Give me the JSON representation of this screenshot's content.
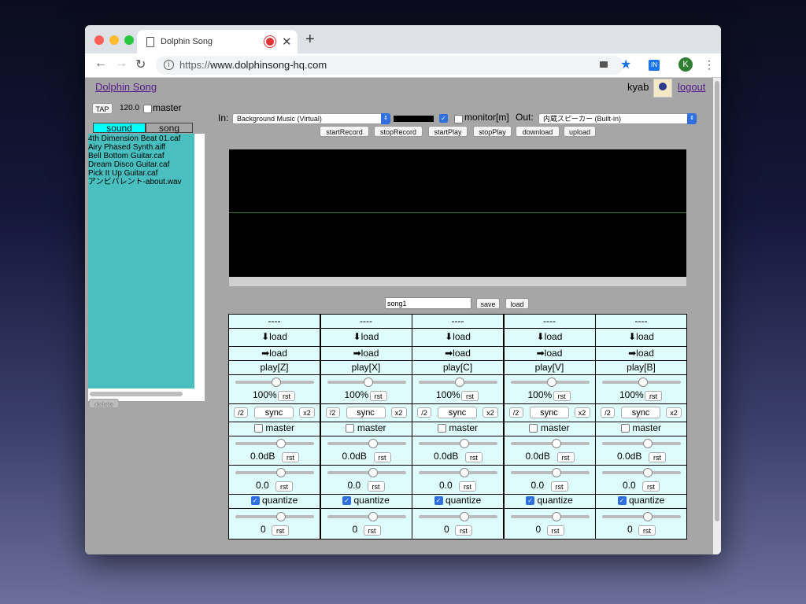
{
  "browser": {
    "tab_title": "Dolphin Song",
    "url_prefix": "https://",
    "url_host": "www.dolphinsong-hq.com",
    "profile_initial": "K",
    "ext_label": "IN"
  },
  "header": {
    "app_link": "Dolphin Song",
    "username": "kyab",
    "logout": "logout"
  },
  "tempo": {
    "tap_label": "TAP",
    "bpm": "120.0",
    "master_label": "master",
    "master_checked": false
  },
  "library": {
    "tabs": [
      "sound",
      "song"
    ],
    "active_tab": "sound",
    "files": [
      "4th Dimension Beat 01.caf",
      "Airy Phased Synth.aiff",
      "Bell Bottom Guitar.caf",
      "Dream Disco Guitar.caf",
      "Pick It Up Guitar.caf",
      "アンビバレント-about.wav"
    ],
    "delete_label": "delete"
  },
  "io": {
    "in_label": "In:",
    "in_device": "Background Music (Virtual)",
    "in_enabled": true,
    "monitor_label": "monitor[m]",
    "monitor_checked": false,
    "out_label": "Out:",
    "out_device": "内蔵スピーカー (Built-in)",
    "buttons": [
      "startRecord",
      "stopRecord",
      "startPlay",
      "stopPlay",
      "download",
      "upload"
    ]
  },
  "song": {
    "name": "song1",
    "save_label": "save",
    "load_label": "load"
  },
  "tracks": [
    {
      "name": "----",
      "load_down": "⬇load",
      "load_right": "➡load",
      "play": "play[Z]",
      "rate": "100%",
      "sync": "sync",
      "half": "/2",
      "double": "x2",
      "master": "master",
      "gain": "0.0dB",
      "pan": "0.0",
      "quantize": "quantize",
      "quantize_on": true,
      "offset": "0",
      "rst": "rst"
    },
    {
      "name": "----",
      "load_down": "⬇load",
      "load_right": "➡load",
      "play": "play[X]",
      "rate": "100%",
      "sync": "sync",
      "half": "/2",
      "double": "x2",
      "master": "master",
      "gain": "0.0dB",
      "pan": "0.0",
      "quantize": "quantize",
      "quantize_on": true,
      "offset": "0",
      "rst": "rst"
    },
    {
      "name": "----",
      "load_down": "⬇load",
      "load_right": "➡load",
      "play": "play[C]",
      "rate": "100%",
      "sync": "sync",
      "half": "/2",
      "double": "x2",
      "master": "master",
      "gain": "0.0dB",
      "pan": "0.0",
      "quantize": "quantize",
      "quantize_on": true,
      "offset": "0",
      "rst": "rst"
    },
    {
      "name": "----",
      "load_down": "⬇load",
      "load_right": "➡load",
      "play": "play[V]",
      "rate": "100%",
      "sync": "sync",
      "half": "/2",
      "double": "x2",
      "master": "master",
      "gain": "0.0dB",
      "pan": "0.0",
      "quantize": "quantize",
      "quantize_on": true,
      "offset": "0",
      "rst": "rst"
    },
    {
      "name": "----",
      "load_down": "⬇load",
      "load_right": "➡load",
      "play": "play[B]",
      "rate": "100%",
      "sync": "sync",
      "half": "/2",
      "double": "x2",
      "master": "master",
      "gain": "0.0dB",
      "pan": "0.0",
      "quantize": "quantize",
      "quantize_on": true,
      "offset": "0",
      "rst": "rst"
    }
  ],
  "colors": {
    "track_bg": "#dffcfc",
    "file_list_bg": "#49bfbf",
    "active_subtab": "#00ffff",
    "link": "#551a8b"
  }
}
